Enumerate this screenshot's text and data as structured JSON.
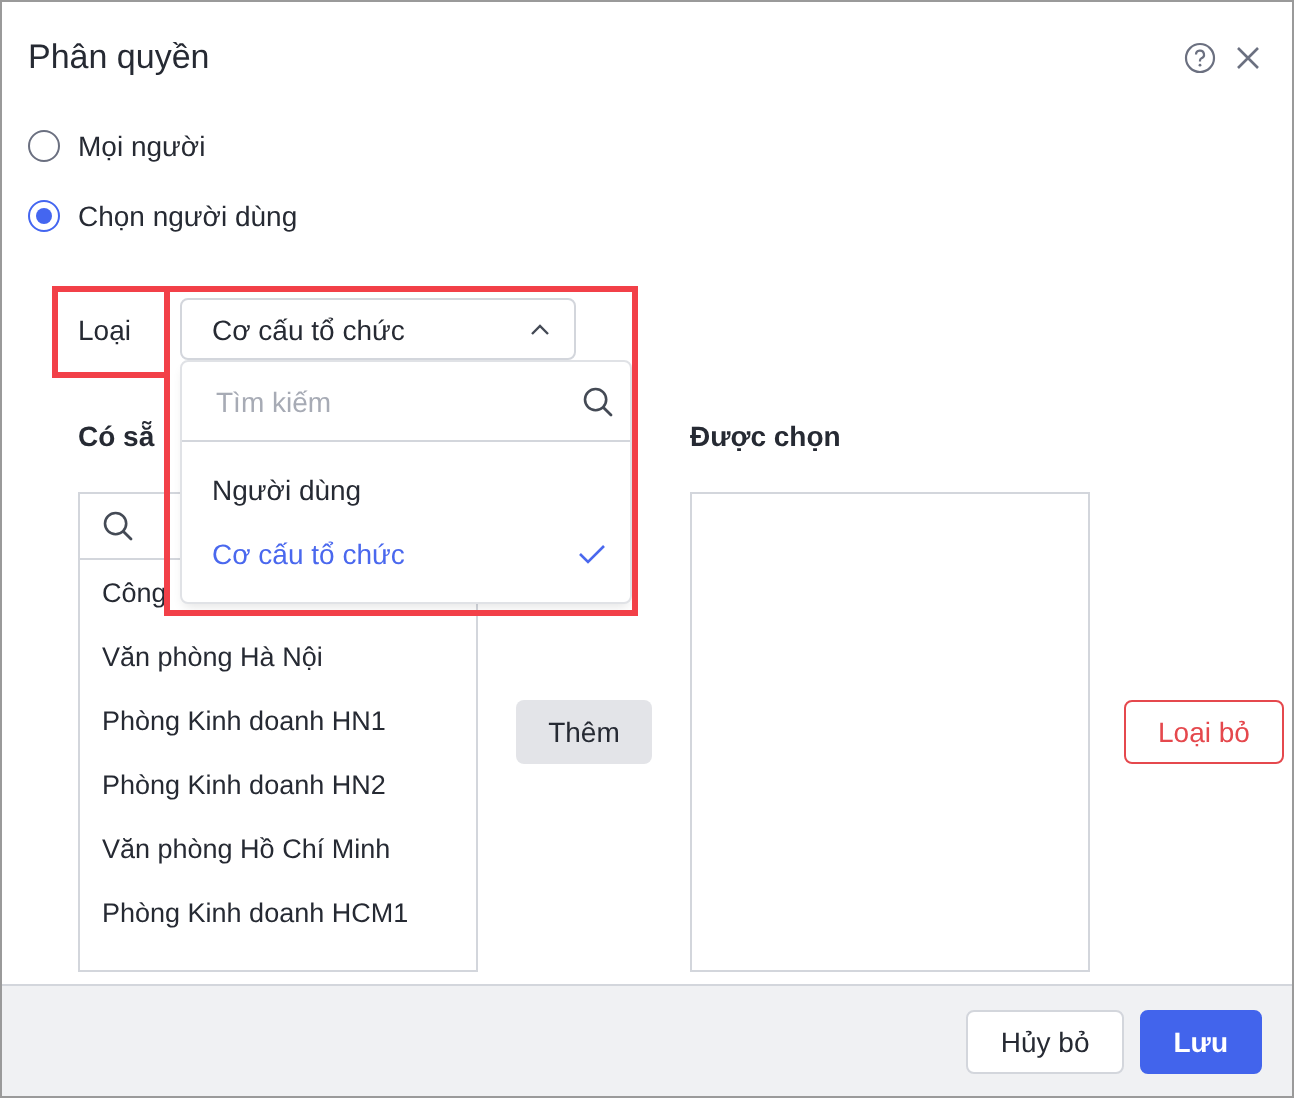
{
  "dialog": {
    "title": "Phân quyền"
  },
  "audience_options": [
    {
      "label": "Mọi người",
      "selected": false
    },
    {
      "label": "Chọn người dùng",
      "selected": true
    }
  ],
  "type_select": {
    "label": "Loại",
    "value": "Cơ cấu tổ chức",
    "expanded": true,
    "search_placeholder": "Tìm kiếm",
    "options": [
      {
        "label": "Người dùng",
        "selected": false
      },
      {
        "label": "Cơ cấu tổ chức",
        "selected": true
      }
    ]
  },
  "available": {
    "heading": "Có sẵ",
    "items": [
      "Công",
      "Văn phòng Hà Nội",
      "Phòng Kinh doanh HN1",
      "Phòng Kinh doanh HN2",
      "Văn phòng Hồ Chí Minh",
      "Phòng Kinh doanh HCM1"
    ]
  },
  "add_button": "Thêm",
  "selected_panel": {
    "heading": "Được chọn"
  },
  "remove_button": "Loại bỏ",
  "footer_buttons": [
    {
      "label": "Hủy bỏ",
      "kind": "secondary"
    },
    {
      "label": "Lưu",
      "kind": "primary"
    }
  ]
}
